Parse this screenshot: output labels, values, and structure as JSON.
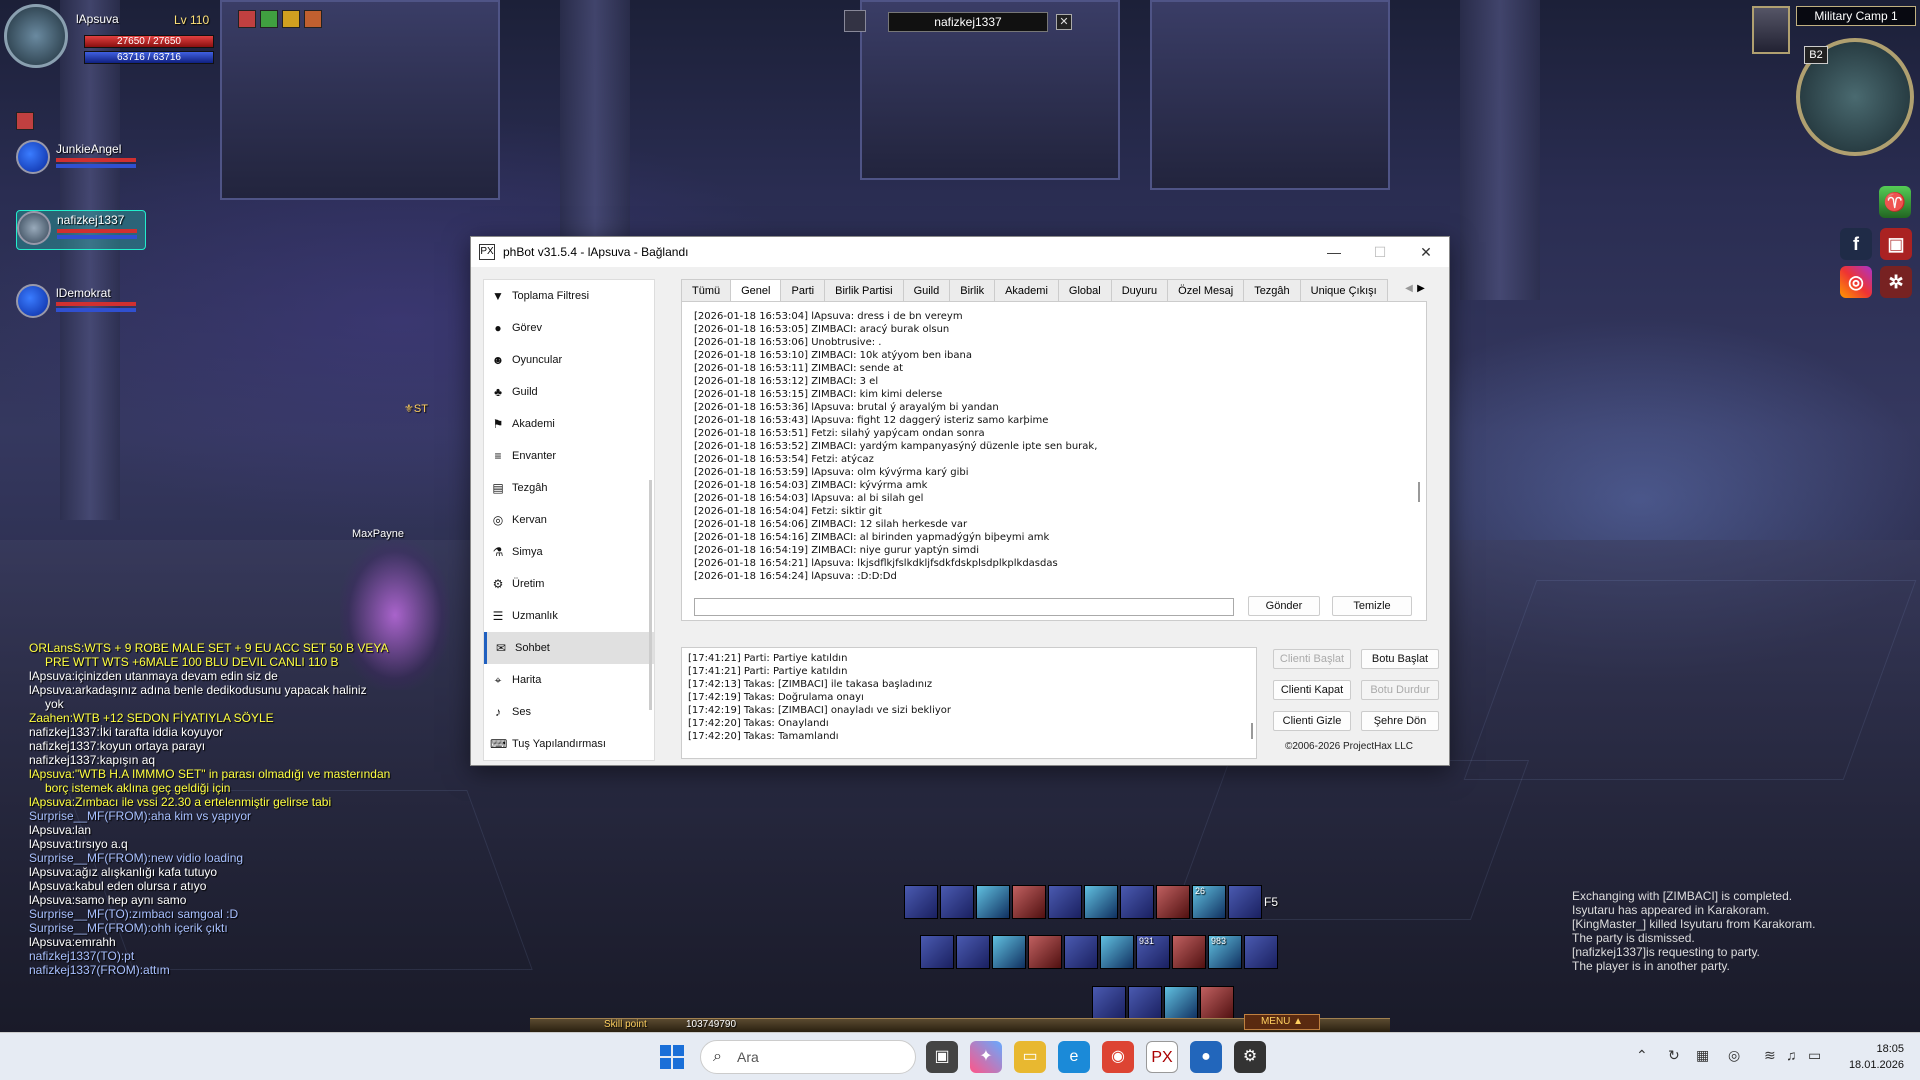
{
  "game": {
    "player": {
      "name": "lApsuva",
      "level": "Lv 110",
      "hp": "27650 / 27650",
      "mp": "63716 / 63716",
      "hp_fill": 1.0,
      "mp_fill": 1.0
    },
    "party": [
      {
        "name": "JunkieAngel"
      },
      {
        "name": "nafizkej1337"
      },
      {
        "name": "lDemokrat"
      }
    ],
    "target": {
      "name": "nafizkej1337",
      "close_icon": "close-icon"
    },
    "location": "Military Camp 1",
    "minimap_floor": "B2",
    "overhead_name": "MaxPayne",
    "guild_tag": "ST",
    "chat": [
      {
        "text": "ORLansS:WTS + 9 ROBE MALE SET + 9 EU ACC SET 50 B VEYA",
        "style": "yellow"
      },
      {
        "text": "PRE WTT WTS +6MALE  100 BLU DEVIL CANLI 110 B",
        "style": "yellow-indent"
      },
      {
        "text": "lApsuva:içinizden utanmaya devam edin siz de",
        "style": "white"
      },
      {
        "text": "lApsuva:arkadaşınız adına benle dedikodusunu yapacak haliniz",
        "style": "white"
      },
      {
        "text": "yok",
        "style": "white-indent"
      },
      {
        "text": "Zaahen:WTB +12 SEDON FİYATIYLA SÖYLE",
        "style": "yellow"
      },
      {
        "text": "nafizkej1337:İki tarafta iddia koyuyor",
        "style": "white"
      },
      {
        "text": "nafizkej1337:koyun ortaya parayı",
        "style": "white"
      },
      {
        "text": "nafizkej1337:kapışın aq",
        "style": "white"
      },
      {
        "text": "lApsuva:\"WTB H.A IMMMO SET\" in parası olmadığı ve masterından",
        "style": "yellow"
      },
      {
        "text": "borç istemek aklına geç geldiği için",
        "style": "yellow-indent"
      },
      {
        "text": "lApsuva:Zımbacı ile vssi 22.30 a ertelenmiştir gelirse tabi",
        "style": "yellow"
      },
      {
        "text": "Surprise__MF(FROM):aha kim vs yapıyor",
        "style": "blue"
      },
      {
        "text": "lApsuva:lan",
        "style": "white"
      },
      {
        "text": "lApsuva:tırsıyo a.q",
        "style": "white"
      },
      {
        "text": "Surprise__MF(FROM):new vidio loading",
        "style": "blue"
      },
      {
        "text": "lApsuva:ağız alışkanlığı kafa tutuyo",
        "style": "white"
      },
      {
        "text": "lApsuva:kabul eden olursa r atıyo",
        "style": "white"
      },
      {
        "text": "lApsuva:samo hep aynı samo",
        "style": "white"
      },
      {
        "text": "Surprise__MF(TO):zımbacı samgoal :D",
        "style": "blue"
      },
      {
        "text": "Surprise__MF(FROM):ohh içerik çıktı",
        "style": "blue"
      },
      {
        "text": "lApsuva:emrahh",
        "style": "white"
      },
      {
        "text": "nafizkej1337(TO):pt",
        "style": "blue"
      },
      {
        "text": "nafizkej1337(FROM):attım",
        "style": "blue"
      }
    ],
    "system_log": [
      "Exchanging with [ZIMBACI] is completed.",
      "Isyutaru has appeared in Karakoram.",
      "[KingMaster_] killed Isyutaru from Karakoram.",
      "The party is dismissed.",
      "[nafizkej1337]is requesting to party.",
      "The player is in another party."
    ],
    "hotkey": "F5",
    "skill_point_label": "Skill point",
    "skill_point_value": "103749790",
    "menu_label": "MENU ▲",
    "skill_counts": [
      "26",
      "931",
      "983"
    ]
  },
  "window": {
    "title": "phBot v31.5.4 - lApsuva - Bağlandı",
    "app_icon": "PX",
    "nav": [
      {
        "label": "Toplama Filtresi",
        "icon": "filter-icon",
        "glyph": "▼"
      },
      {
        "label": "Görev",
        "icon": "quest-icon",
        "glyph": "●"
      },
      {
        "label": "Oyuncular",
        "icon": "players-icon",
        "glyph": "☻"
      },
      {
        "label": "Guild",
        "icon": "guild-icon",
        "glyph": "♣"
      },
      {
        "label": "Akademi",
        "icon": "academy-icon",
        "glyph": "⚑"
      },
      {
        "label": "Envanter",
        "icon": "inventory-icon",
        "glyph": "≡"
      },
      {
        "label": "Tezgâh",
        "icon": "stall-icon",
        "glyph": "▤"
      },
      {
        "label": "Kervan",
        "icon": "caravan-icon",
        "glyph": "◎"
      },
      {
        "label": "Simya",
        "icon": "alchemy-icon",
        "glyph": "⚗"
      },
      {
        "label": "Üretim",
        "icon": "crafting-icon",
        "glyph": "⚙"
      },
      {
        "label": "Uzmanlık",
        "icon": "mastery-icon",
        "glyph": "☰"
      },
      {
        "label": "Sohbet",
        "icon": "chat-icon",
        "glyph": "✉"
      },
      {
        "label": "Harita",
        "icon": "map-pin-icon",
        "glyph": "⌖"
      },
      {
        "label": "Ses",
        "icon": "bell-icon",
        "glyph": "♪"
      },
      {
        "label": "Tuş Yapılandırması",
        "icon": "keyboard-icon",
        "glyph": "⌨"
      }
    ],
    "active_nav": "Sohbet",
    "tabs": [
      "Tümü",
      "Genel",
      "Parti",
      "Birlik Partisi",
      "Guild",
      "Birlik",
      "Akademi",
      "Global",
      "Duyuru",
      "Özel Mesaj",
      "Tezgâh",
      "Unique Çıkışı"
    ],
    "active_tab": "Genel",
    "messages": [
      "[2026-01-18 16:53:04] lApsuva: dress i de bn vereym",
      "[2026-01-18 16:53:05] ZIMBACI: aracý burak olsun",
      "[2026-01-18 16:53:06] Unobtrusive: .",
      "[2026-01-18 16:53:10] ZIMBACI: 10k atýyom ben ibana",
      "[2026-01-18 16:53:11] ZIMBACI: sende at",
      "[2026-01-18 16:53:12] ZIMBACI: 3 el",
      "[2026-01-18 16:53:15] ZIMBACI: kim kimi delerse",
      "[2026-01-18 16:53:36] lApsuva: brutal ý arayalým bi yandan",
      "[2026-01-18 16:53:43] lApsuva: fight 12 daggerý isteriz samo karþime",
      "[2026-01-18 16:53:51] Fetzi: silahý yapýcam ondan sonra",
      "[2026-01-18 16:53:52] ZIMBACI: yardým kampanyasýný düzenle ipte sen burak,",
      "[2026-01-18 16:53:54] Fetzi: atýcaz",
      "[2026-01-18 16:53:59] lApsuva: olm kývýrma karý gibi",
      "[2026-01-18 16:54:03] ZIMBACI: kývýrma amk",
      "[2026-01-18 16:54:03] lApsuva: al bi silah gel",
      "[2026-01-18 16:54:04] Fetzi: siktir git",
      "[2026-01-18 16:54:06] ZIMBACI: 12 silah herkesde var",
      "[2026-01-18 16:54:16] ZIMBACI: al birinden yapmadýgýn biþeymi amk",
      "[2026-01-18 16:54:19] ZIMBACI: niye gurur yaptýn simdi",
      "[2026-01-18 16:54:21] lApsuva: lkjsdflkjfslkdkljfsdkfdskplsdplkplkdasdas",
      "[2026-01-18 16:54:24] lApsuva: :D:D:Dd"
    ],
    "send_label": "Gönder",
    "clear_label": "Temizle",
    "log": [
      "[17:41:21] Parti: Partiye katıldın",
      "[17:41:21] Parti: Partiye katıldın",
      "[17:42:13] Takas: [ZIMBACI] ile takasa başladınız",
      "[17:42:19] Takas: Doğrulama onayı",
      "[17:42:19] Takas: [ZIMBACI] onayladı ve sizi bekliyor",
      "[17:42:20] Takas: Onaylandı",
      "[17:42:20] Takas: Tamamlandı"
    ],
    "buttons": {
      "start_client": "Clienti Başlat",
      "start_bot": "Botu Başlat",
      "close_client": "Clienti Kapat",
      "stop_bot": "Botu Durdur",
      "hide_client": "Clienti Gizle",
      "return_town": "Şehre Dön"
    },
    "copyright": "©2006-2026 ProjectHax LLC"
  },
  "taskbar": {
    "search_placeholder": "Ara",
    "time": "18:05",
    "date": "18.01.2026"
  },
  "colors": {
    "accent": "#1a6fd8",
    "chat_yellow": "#ffff40",
    "chat_blue": "#a8c0ff"
  }
}
